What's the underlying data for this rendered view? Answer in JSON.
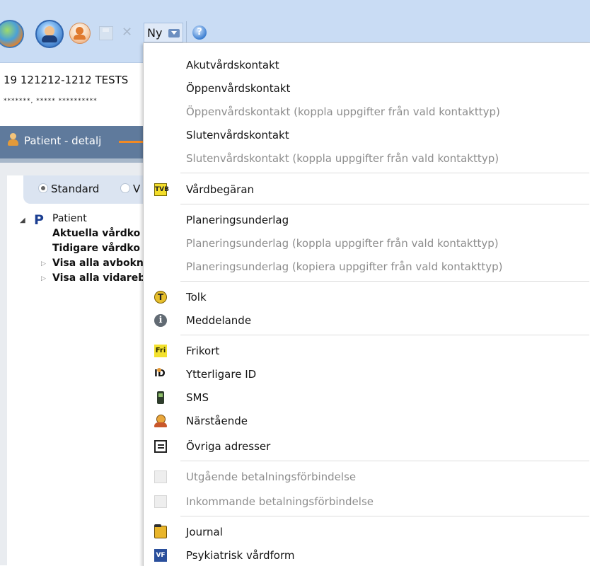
{
  "toolbar": {
    "ny_label": "Ny"
  },
  "patient": {
    "id_line": "19 121212-1212 TESTS",
    "name_line": "*******, ***** **********"
  },
  "detail": {
    "title": "Patient - detalj"
  },
  "view_options": {
    "standard_label": "Standard",
    "second_label": "V"
  },
  "tree": {
    "root_label": "Patient",
    "items": [
      "Aktuella vårdko",
      "Tidigare vårdko",
      "Visa alla avbokn",
      "Visa alla vidareb"
    ]
  },
  "menu": {
    "items": [
      {
        "label": "Akutvårdskontakt",
        "enabled": true,
        "icon": ""
      },
      {
        "label": "Öppenvårdskontakt",
        "enabled": true,
        "icon": ""
      },
      {
        "label": "Öppenvårdskontakt (koppla uppgifter från vald kontakttyp)",
        "enabled": false,
        "icon": ""
      },
      {
        "label": "Slutenvårdskontakt",
        "enabled": true,
        "icon": ""
      },
      {
        "label": "Slutenvårdskontakt (koppla uppgifter från vald kontakttyp)",
        "enabled": false,
        "icon": ""
      },
      {
        "label": "Vårdbegäran",
        "enabled": true,
        "icon": "tvb-icon"
      },
      {
        "label": "Planeringsunderlag",
        "enabled": true,
        "icon": ""
      },
      {
        "label": "Planeringsunderlag (koppla uppgifter från vald kontakttyp)",
        "enabled": false,
        "icon": ""
      },
      {
        "label": "Planeringsunderlag (kopiera uppgifter från vald kontakttyp)",
        "enabled": false,
        "icon": ""
      },
      {
        "label": "Tolk",
        "enabled": true,
        "icon": "tolk-icon"
      },
      {
        "label": "Meddelande",
        "enabled": true,
        "icon": "info-icon"
      },
      {
        "label": "Frikort",
        "enabled": true,
        "icon": "frikort-icon"
      },
      {
        "label": "Ytterligare ID",
        "enabled": true,
        "icon": "id-icon"
      },
      {
        "label": "SMS",
        "enabled": true,
        "icon": "mobile-phone-icon"
      },
      {
        "label": "Närstående",
        "enabled": true,
        "icon": "relative-person-icon"
      },
      {
        "label": "Övriga adresser",
        "enabled": true,
        "icon": "address-card-icon"
      },
      {
        "label": "Utgående betalningsförbindelse",
        "enabled": false,
        "icon": "payment-out-icon"
      },
      {
        "label": "Inkommande betalningsförbindelse",
        "enabled": false,
        "icon": "payment-in-icon"
      },
      {
        "label": "Journal",
        "enabled": true,
        "icon": "journal-folder-icon"
      },
      {
        "label": "Psykiatrisk vårdform",
        "enabled": true,
        "icon": "vf-icon"
      }
    ],
    "icon_text": {
      "tvb": "TVB",
      "tolk": "T",
      "info": "i",
      "fri": "Fri",
      "id": "ID",
      "vf": "VF"
    }
  }
}
